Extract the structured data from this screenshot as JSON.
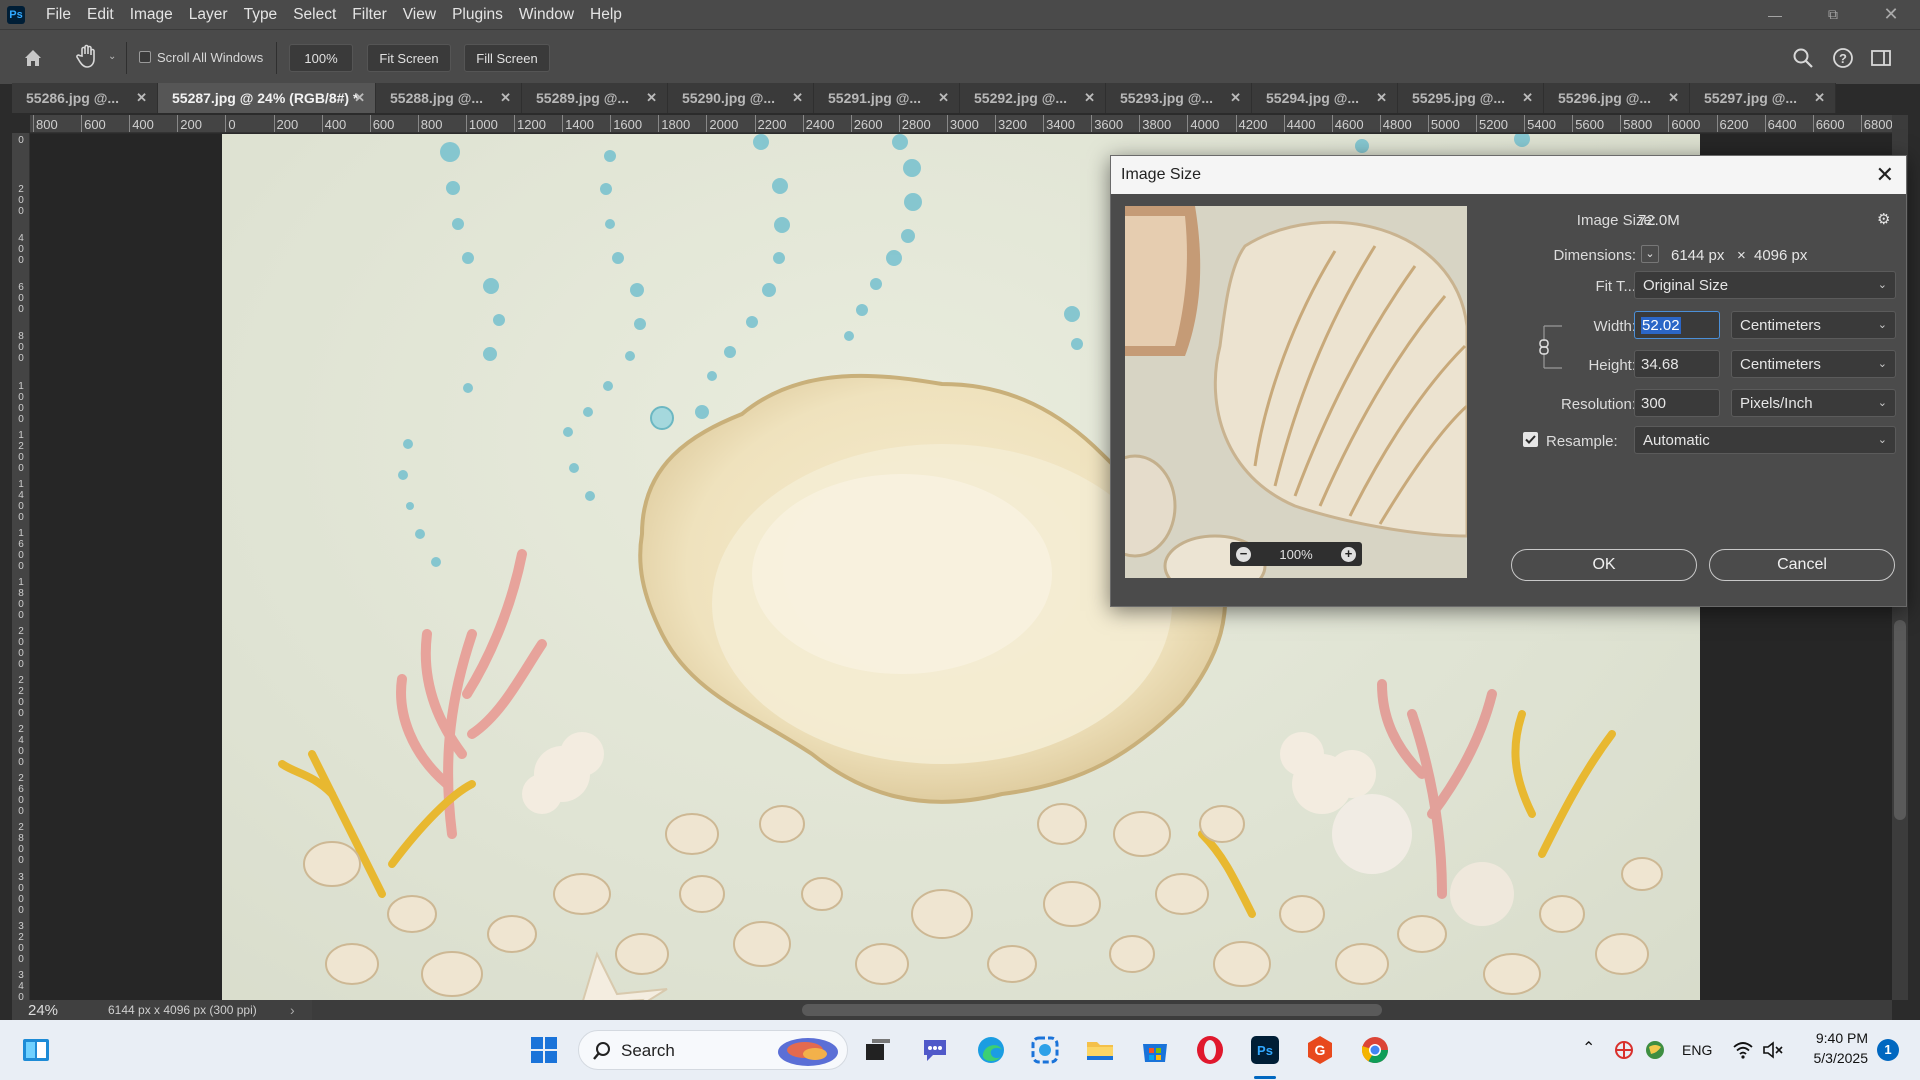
{
  "app": {
    "logo": "Ps",
    "menu": [
      "File",
      "Edit",
      "Image",
      "Layer",
      "Type",
      "Select",
      "Filter",
      "View",
      "Plugins",
      "Window",
      "Help"
    ]
  },
  "options_bar": {
    "scroll_all_label": "Scroll All Windows",
    "scroll_all_checked": false,
    "zoom_button": "100%",
    "fit_screen": "Fit Screen",
    "fill_screen": "Fill Screen"
  },
  "tabs": [
    {
      "label": "55286.jpg @...",
      "active": false
    },
    {
      "label": "55287.jpg @ 24% (RGB/8#) *",
      "active": true
    },
    {
      "label": "55288.jpg @...",
      "active": false
    },
    {
      "label": "55289.jpg @...",
      "active": false
    },
    {
      "label": "55290.jpg @...",
      "active": false
    },
    {
      "label": "55291.jpg @...",
      "active": false
    },
    {
      "label": "55292.jpg @...",
      "active": false
    },
    {
      "label": "55293.jpg @...",
      "active": false
    },
    {
      "label": "55294.jpg @...",
      "active": false
    },
    {
      "label": "55295.jpg @...",
      "active": false
    },
    {
      "label": "55296.jpg @...",
      "active": false
    },
    {
      "label": "55297.jpg @...",
      "active": false
    }
  ],
  "ruler_top": [
    "800",
    "600",
    "400",
    "200",
    "0",
    "200",
    "400",
    "600",
    "800",
    "1000",
    "1200",
    "1400",
    "1600",
    "1800",
    "2000",
    "2200",
    "2400",
    "2600",
    "2800",
    "3000",
    "3200",
    "3400",
    "3600",
    "3800",
    "4000",
    "4200",
    "4400",
    "4600",
    "4800",
    "5000",
    "5200",
    "5400",
    "5600",
    "5800",
    "6000",
    "6200",
    "6400",
    "6600",
    "6800"
  ],
  "ruler_left": [
    "0",
    "200",
    "400",
    "600",
    "800",
    "1000",
    "1200",
    "1400",
    "1600",
    "1800",
    "2000",
    "2200",
    "2400",
    "2600",
    "2800",
    "3000",
    "3200",
    "3400"
  ],
  "status": {
    "zoom": "24%",
    "doc_info": "6144 px x 4096 px (300 ppi)"
  },
  "dialog": {
    "title": "Image Size",
    "preview_zoom": "100%",
    "image_size_label": "Image Size:",
    "image_size_value": "72.0M",
    "dimensions_label": "Dimensions:",
    "dim_width": "6144 px",
    "dim_times": "×",
    "dim_height": "4096 px",
    "fit_label": "Fit T...",
    "fit_value": "Original Size",
    "width_label": "Width:",
    "width_value": "52.02",
    "width_unit": "Centimeters",
    "height_label": "Height:",
    "height_value": "34.68",
    "height_unit": "Centimeters",
    "resolution_label": "Resolution:",
    "resolution_value": "300",
    "resolution_unit": "Pixels/Inch",
    "resample_label": "Resample:",
    "resample_checked": true,
    "resample_value": "Automatic",
    "ok": "OK",
    "cancel": "Cancel"
  },
  "taskbar": {
    "search_label": "Search",
    "lang": "ENG",
    "time": "9:40 PM",
    "date": "5/3/2025",
    "notification_count": "1"
  }
}
